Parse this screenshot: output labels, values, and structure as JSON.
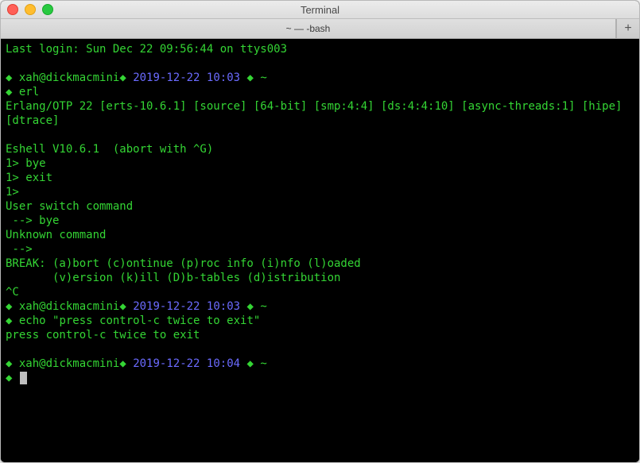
{
  "window": {
    "title": "Terminal",
    "tab_title": "~ — -bash",
    "new_tab_glyph": "+"
  },
  "colors": {
    "green": "#34d534",
    "blue": "#6b6bff",
    "bg": "#000000"
  },
  "session": {
    "last_login": "Last login: Sun Dec 22 09:56:44 on ttys003",
    "prompts": [
      {
        "bullet": "◆",
        "host": "xah@dickmacmini",
        "sep": "◆",
        "time": "2019-12-22 10:03",
        "sep2": "◆",
        "cwd": "~"
      },
      {
        "bullet": "◆",
        "host": "xah@dickmacmini",
        "sep": "◆",
        "time": "2019-12-22 10:03",
        "sep2": "◆",
        "cwd": "~"
      },
      {
        "bullet": "◆",
        "host": "xah@dickmacmini",
        "sep": "◆",
        "time": "2019-12-22 10:04",
        "sep2": "◆",
        "cwd": "~"
      }
    ],
    "cmd_erl": {
      "bullet": "◆",
      "text": "erl"
    },
    "erl_banner": "Erlang/OTP 22 [erts-10.6.1] [source] [64-bit] [smp:4:4] [ds:4:4:10] [async-threads:1] [hipe] [dtrace]",
    "eshell": "Eshell V10.6.1  (abort with ^G)",
    "shell_lines": [
      "1> bye",
      "1> exit",
      "1>"
    ],
    "user_switch": "User switch command",
    "arrow_bye": " --> bye",
    "unknown": "Unknown command",
    "arrow": " -->",
    "break1": "BREAK: (a)bort (c)ontinue (p)roc info (i)nfo (l)oaded",
    "break2": "       (v)ersion (k)ill (D)b-tables (d)istribution",
    "ctrl_c": "^C",
    "cmd_echo": {
      "bullet": "◆",
      "text": "echo \"press control-c twice to exit\""
    },
    "echo_out": "press control-c twice to exit",
    "final_bullet": "◆"
  }
}
